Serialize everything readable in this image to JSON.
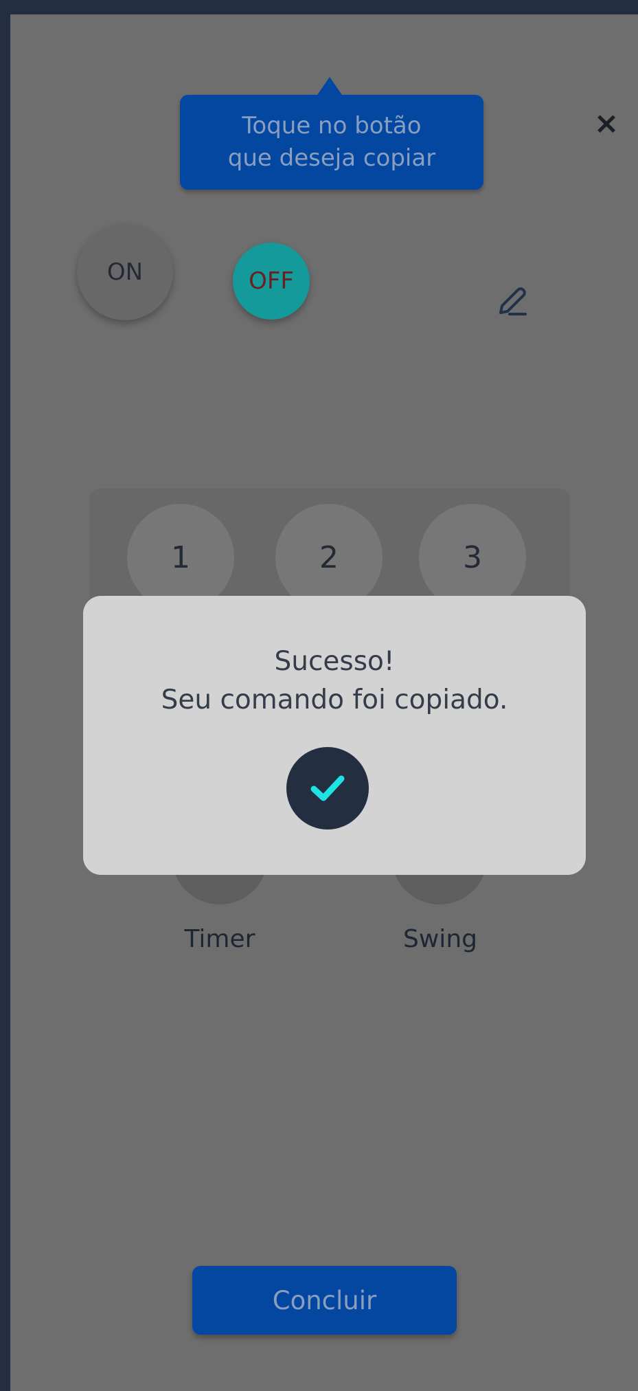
{
  "colors": {
    "background": "#232f41",
    "screen_overlay": "#6e6e6e",
    "primary": "#0447a0",
    "off_button": "#149a9a",
    "dialog_background": "#d3d3d3",
    "check_circle": "#232f41",
    "check_mark": "#1fe3e3"
  },
  "header": {
    "close_icon": "×",
    "icon_names": {
      "close": "close-icon",
      "edit": "pencil-icon"
    }
  },
  "tooltip": {
    "text": "Toque no botão\nque deseja copiar"
  },
  "power": {
    "on_label": "ON",
    "off_label": "OFF"
  },
  "remote": {
    "numbers": [
      "1",
      "2",
      "3"
    ],
    "timer_label": "Timer",
    "swing_label": "Swing"
  },
  "dialog": {
    "title": "Sucesso!",
    "message": "Seu comando foi copiado.",
    "icon": "check-icon"
  },
  "footer": {
    "concluir_label": "Concluir"
  }
}
